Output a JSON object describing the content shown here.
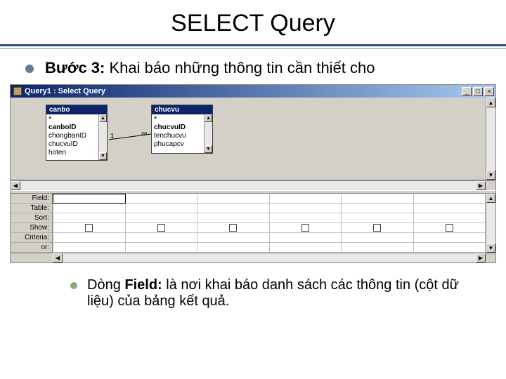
{
  "title": "SELECT Query",
  "step_label": "Bước 3:",
  "step_text": " Khai báo những thông tin cần thiết cho",
  "sub_label": "Field:",
  "sub_prefix": "Dòng ",
  "sub_text": " là nơi khai báo danh sách các thông tin (cột dữ liệu) của bảng kết quả.",
  "window": {
    "title": "Query1 : Select Query",
    "min": "_",
    "max": "□",
    "close": "×"
  },
  "tables": {
    "canbo": {
      "header": "canbo",
      "fields": [
        "*",
        "canboID",
        "chongbanID",
        "chucvuID",
        "hoten"
      ]
    },
    "chucvu": {
      "header": "chucvu",
      "fields": [
        "*",
        "chucvuID",
        "tenchucvu",
        "phucapcv"
      ]
    }
  },
  "relation": {
    "left": "1",
    "right": "∞"
  },
  "grid_labels": [
    "Field:",
    "Table:",
    "Sort:",
    "Show:",
    "Criteria:",
    "or:"
  ],
  "arrows": {
    "up": "▲",
    "down": "▼",
    "left": "◀",
    "right": "▶"
  }
}
